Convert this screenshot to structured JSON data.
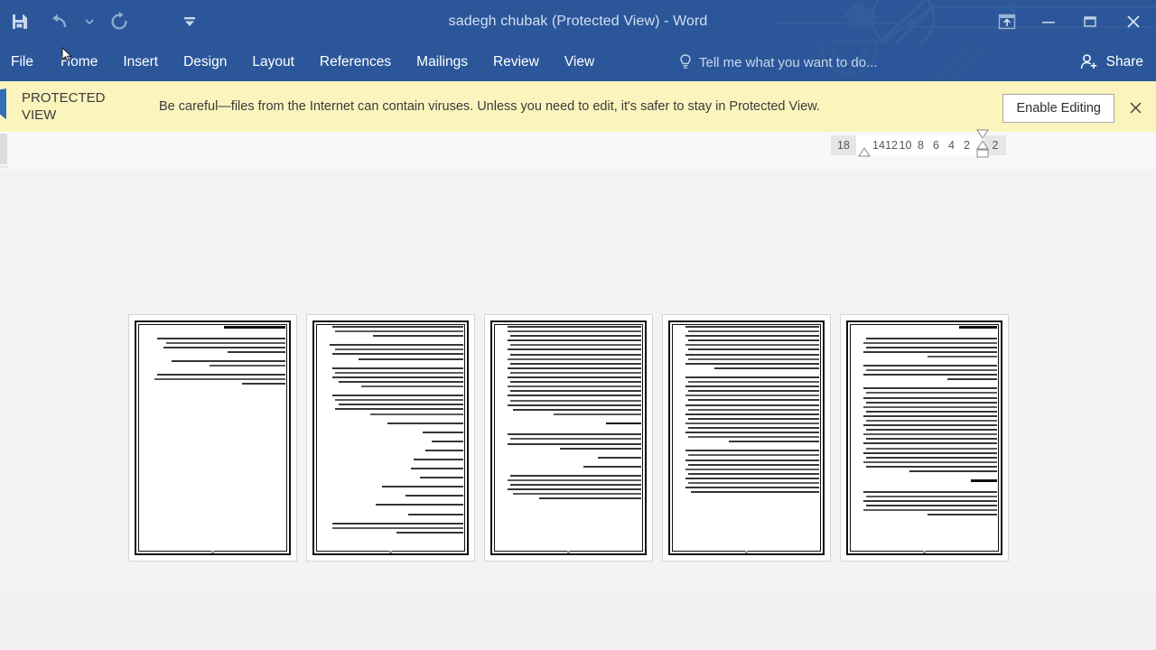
{
  "window": {
    "title": "sadegh chubak (Protected View) - Word",
    "accent_color": "#2b579a",
    "controls": [
      {
        "name": "ribbon-display-options",
        "glyph": "ribbon"
      },
      {
        "name": "minimize",
        "glyph": "minimize"
      },
      {
        "name": "restore",
        "glyph": "restore"
      },
      {
        "name": "close",
        "glyph": "close"
      }
    ]
  },
  "quick_access": [
    {
      "name": "save",
      "label": "Save"
    },
    {
      "name": "undo",
      "label": "Undo"
    },
    {
      "name": "undo-dropdown",
      "label": "Undo options"
    },
    {
      "name": "redo",
      "label": "Redo"
    },
    {
      "name": "customize-quick-access-toolbar",
      "label": "Customize Quick Access Toolbar"
    }
  ],
  "ribbon": {
    "tabs": [
      {
        "label": "File"
      },
      {
        "label": "Home"
      },
      {
        "label": "Insert"
      },
      {
        "label": "Design"
      },
      {
        "label": "Layout"
      },
      {
        "label": "References"
      },
      {
        "label": "Mailings"
      },
      {
        "label": "Review"
      },
      {
        "label": "View"
      }
    ],
    "tell_me": "Tell me what you want to do...",
    "share_label": "Share"
  },
  "protected_view": {
    "badge": "PROTECTED VIEW",
    "badge_line1": "PROTECTED",
    "badge_line2": "VIEW",
    "message": "Be careful—files from the Internet can contain viruses. Unless you need to edit, it's safer to stay in Protected View.",
    "enable_button": "Enable Editing",
    "close_label": "✕",
    "background_color": "#fbf4bd"
  },
  "ruler": {
    "ticks": [
      "18",
      "14",
      "12",
      "10",
      "8",
      "6",
      "4",
      "2",
      "2"
    ],
    "left_indent_marker": "first-line-indent",
    "right_indent_marker": "hanging-indent"
  },
  "document": {
    "zoom_level": "",
    "page_count": 5,
    "script_direction": "rtl",
    "pages": [
      {
        "number": "1",
        "page_label": "page-thumbnail-1",
        "blocks": [
          {
            "type": "heading",
            "widths": [
              42
            ]
          },
          {
            "type": "paragraph",
            "widths": [
              88,
              82,
              84,
              40
            ]
          },
          {
            "type": "paragraph",
            "widths": [
              78,
              52
            ]
          },
          {
            "type": "paragraph",
            "widths": [
              88,
              90,
              30
            ]
          }
        ]
      },
      {
        "number": "2",
        "page_label": "page-thumbnail-2",
        "blocks": [
          {
            "type": "paragraph",
            "widths": [
              90,
              88,
              62
            ]
          },
          {
            "type": "paragraph",
            "widths": [
              92,
              88,
              90,
              72
            ]
          },
          {
            "type": "paragraph",
            "widths": [
              90,
              88,
              90,
              86,
              70
            ]
          },
          {
            "type": "paragraph",
            "widths": [
              90,
              88,
              86,
              88,
              64
            ]
          },
          {
            "type": "paragraph",
            "widths": [
              52
            ]
          },
          {
            "type": "paragraph",
            "widths": [
              28
            ]
          },
          {
            "type": "paragraph",
            "widths": [
              22
            ]
          },
          {
            "type": "paragraph",
            "widths": [
              26
            ]
          },
          {
            "type": "paragraph",
            "widths": [
              34
            ]
          },
          {
            "type": "paragraph",
            "widths": [
              36
            ]
          },
          {
            "type": "paragraph",
            "widths": [
              30
            ]
          },
          {
            "type": "paragraph",
            "widths": [
              56
            ]
          },
          {
            "type": "paragraph",
            "widths": [
              40
            ]
          },
          {
            "type": "paragraph",
            "widths": [
              60
            ]
          },
          {
            "type": "paragraph",
            "widths": [
              38
            ]
          },
          {
            "type": "paragraph",
            "widths": [
              90,
              90,
              46
            ]
          }
        ]
      },
      {
        "number": "3",
        "page_label": "page-thumbnail-3",
        "blocks": [
          {
            "type": "paragraph",
            "widths": [
              92,
              92,
              90,
              92,
              90,
              92,
              90,
              92,
              90,
              92,
              90,
              92,
              90,
              92,
              90,
              92,
              90,
              92,
              88,
              60
            ]
          },
          {
            "type": "heading",
            "widths": [
              24
            ]
          },
          {
            "type": "paragraph",
            "widths": [
              92,
              90,
              92,
              56
            ]
          },
          {
            "type": "paragraph",
            "widths": [
              30
            ]
          },
          {
            "type": "paragraph",
            "widths": [
              40
            ]
          },
          {
            "type": "paragraph",
            "widths": [
              90,
              92,
              90,
              92,
              88,
              70
            ]
          }
        ]
      },
      {
        "number": "4",
        "page_label": "page-thumbnail-4",
        "blocks": [
          {
            "type": "paragraph",
            "widths": [
              92,
              90,
              92,
              90,
              92,
              90,
              92,
              90,
              92,
              72
            ]
          },
          {
            "type": "paragraph",
            "widths": [
              92,
              90,
              92,
              90,
              92,
              90,
              92,
              90,
              92,
              90,
              92,
              90,
              92,
              90,
              62
            ]
          },
          {
            "type": "paragraph",
            "widths": [
              92,
              90,
              92,
              90,
              92,
              90,
              92,
              90,
              92,
              88
            ]
          }
        ]
      },
      {
        "number": "5",
        "page_label": "page-thumbnail-5",
        "blocks": [
          {
            "type": "heading",
            "widths": [
              26
            ]
          },
          {
            "type": "paragraph",
            "widths": [
              90,
              92,
              90,
              92,
              48
            ]
          },
          {
            "type": "paragraph",
            "widths": [
              92,
              90,
              92,
              34
            ]
          },
          {
            "type": "paragraph",
            "widths": [
              92,
              90,
              92,
              90,
              92,
              90,
              92,
              90,
              92,
              90,
              92,
              90,
              92,
              90,
              92,
              90,
              92,
              90,
              60
            ]
          },
          {
            "type": "heading",
            "widths": [
              18
            ]
          },
          {
            "type": "paragraph",
            "widths": [
              92,
              90,
              92,
              90,
              92,
              48
            ]
          }
        ]
      }
    ]
  }
}
